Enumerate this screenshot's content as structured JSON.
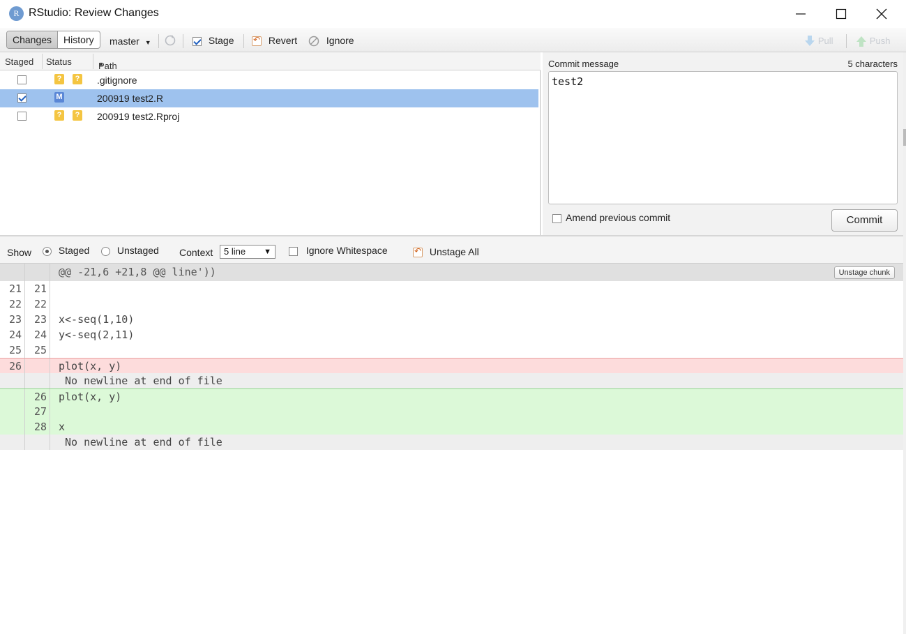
{
  "window": {
    "title": "RStudio: Review Changes",
    "icon_letter": "R"
  },
  "toolbar": {
    "changes_label": "Changes",
    "history_label": "History",
    "branch": "master",
    "stage_label": "Stage",
    "revert_label": "Revert",
    "ignore_label": "Ignore",
    "pull_label": "Pull",
    "push_label": "Push"
  },
  "filelist": {
    "headers": {
      "staged": "Staged",
      "status": "Status",
      "path": "Path"
    },
    "rows": [
      {
        "staged": false,
        "status": [
          "?",
          "?"
        ],
        "path": ".gitignore"
      },
      {
        "staged": true,
        "status": [
          "M"
        ],
        "path": "200919 test2.R"
      },
      {
        "staged": false,
        "status": [
          "?",
          "?"
        ],
        "path": "200919 test2.Rproj"
      }
    ]
  },
  "commit": {
    "label": "Commit message",
    "char_count": "5 characters",
    "message": "test2",
    "amend_label": "Amend previous commit",
    "button": "Commit"
  },
  "difftoolbar": {
    "show_label": "Show",
    "staged_label": "Staged",
    "unstaged_label": "Unstaged",
    "context_label": "Context",
    "context_value": "5 line",
    "ignore_ws_label": "Ignore Whitespace",
    "unstage_all_label": "Unstage All"
  },
  "diff": {
    "hunk_header": "@@ -21,6 +21,8 @@ line'))",
    "unstage_chunk_label": "Unstage chunk",
    "lines": [
      {
        "old": "21",
        "new": "21",
        "text": "",
        "type": "ctx"
      },
      {
        "old": "22",
        "new": "22",
        "text": "",
        "type": "ctx"
      },
      {
        "old": "23",
        "new": "23",
        "text": "x<-seq(1,10)",
        "type": "ctx"
      },
      {
        "old": "24",
        "new": "24",
        "text": "y<-seq(2,11)",
        "type": "ctx"
      },
      {
        "old": "25",
        "new": "25",
        "text": "",
        "type": "ctx"
      },
      {
        "old": "26",
        "new": "",
        "text": "plot(x, y)",
        "type": "del"
      },
      {
        "old": "",
        "new": "",
        "text": " No newline at end of file",
        "type": "info"
      },
      {
        "old": "",
        "new": "26",
        "text": "plot(x, y)",
        "type": "add"
      },
      {
        "old": "",
        "new": "27",
        "text": "",
        "type": "add"
      },
      {
        "old": "",
        "new": "28",
        "text": "x",
        "type": "add"
      },
      {
        "old": "",
        "new": "",
        "text": " No newline at end of file",
        "type": "info"
      }
    ]
  }
}
